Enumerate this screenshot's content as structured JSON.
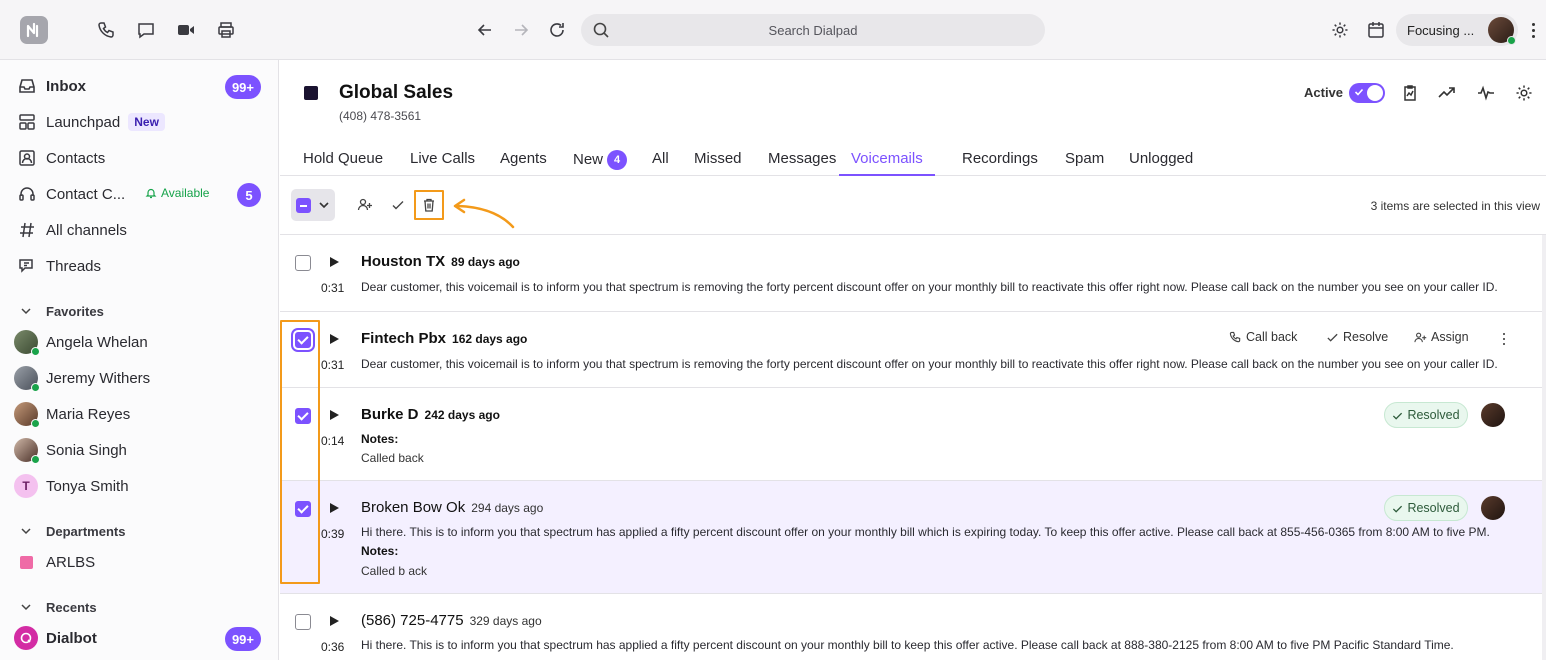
{
  "topbar": {
    "search_placeholder": "Search Dialpad",
    "status_label": "Focusing ..."
  },
  "sidebar": {
    "inbox": {
      "label": "Inbox",
      "badge": "99+"
    },
    "launchpad": {
      "label": "Launchpad",
      "tag": "New"
    },
    "contacts": {
      "label": "Contacts"
    },
    "contact_center": {
      "label": "Contact C...",
      "status": "Available",
      "badge": "5"
    },
    "all_channels": {
      "label": "All channels"
    },
    "threads": {
      "label": "Threads"
    },
    "favorites_header": "Favorites",
    "favorites": [
      "Angela Whelan",
      "Jeremy Withers",
      "Maria Reyes",
      "Sonia Singh",
      "Tonya Smith"
    ],
    "tonya_initial": "T",
    "departments_header": "Departments",
    "departments": [
      "ARLBS"
    ],
    "recents_header": "Recents",
    "dialbot": {
      "label": "Dialbot",
      "badge": "99+"
    }
  },
  "header": {
    "title": "Global Sales",
    "phone": "(408) 478-3561",
    "active_label": "Active"
  },
  "tabs": [
    {
      "label": "Hold Queue"
    },
    {
      "label": "Live Calls"
    },
    {
      "label": "Agents"
    },
    {
      "label": "New",
      "count": "4"
    },
    {
      "label": "All"
    },
    {
      "label": "Missed"
    },
    {
      "label": "Messages"
    },
    {
      "label": "Voicemails"
    },
    {
      "label": "Recordings"
    },
    {
      "label": "Spam"
    },
    {
      "label": "Unlogged"
    }
  ],
  "toolbar": {
    "selection_text": "3 items are selected in this view"
  },
  "voicemails": [
    {
      "name": "Houston TX",
      "ago": "89 days ago",
      "duration": "0:31",
      "checked": false,
      "message": "Dear customer, this voicemail is to inform you that spectrum is removing the forty percent discount offer on your monthly bill to reactivate this offer right now. Please call back on the number you see on your caller ID."
    },
    {
      "name": "Fintech Pbx",
      "ago": "162 days ago",
      "duration": "0:31",
      "checked": true,
      "message": "Dear customer, this voicemail is to inform you that spectrum is removing the forty percent discount offer on your monthly bill to reactivate this offer right now. Please call back on the number you see on your caller ID.",
      "actions": {
        "call_back": "Call back",
        "resolve": "Resolve",
        "assign": "Assign"
      }
    },
    {
      "name": "Burke D",
      "ago": "242 days ago",
      "duration": "0:14",
      "checked": true,
      "notes_label": "Notes:",
      "notes": "Called back",
      "status": "Resolved"
    },
    {
      "name": "Broken Bow Ok",
      "ago": "294 days ago",
      "duration": "0:39",
      "checked": true,
      "message": "Hi there. This is to inform you that spectrum has applied a fifty percent discount offer on your monthly bill which is expiring today. To keep this offer active. Please call back at 855-456-0365 from 8:00 AM to five PM.",
      "notes_label": "Notes:",
      "notes": "Called b ack",
      "status": "Resolved"
    },
    {
      "name": "(586) 725-4775",
      "ago": "329 days ago",
      "duration": "0:36",
      "checked": false,
      "message": "Hi there. This is to inform you that spectrum has applied a fifty percent discount on your monthly bill to keep this offer active. Please call back at 888-380-2125 from 8:00 AM to five PM Pacific Standard Time."
    }
  ],
  "colors": {
    "accent": "#7c52ff",
    "highlight": "#f39a1a",
    "online": "#1aa34a"
  }
}
